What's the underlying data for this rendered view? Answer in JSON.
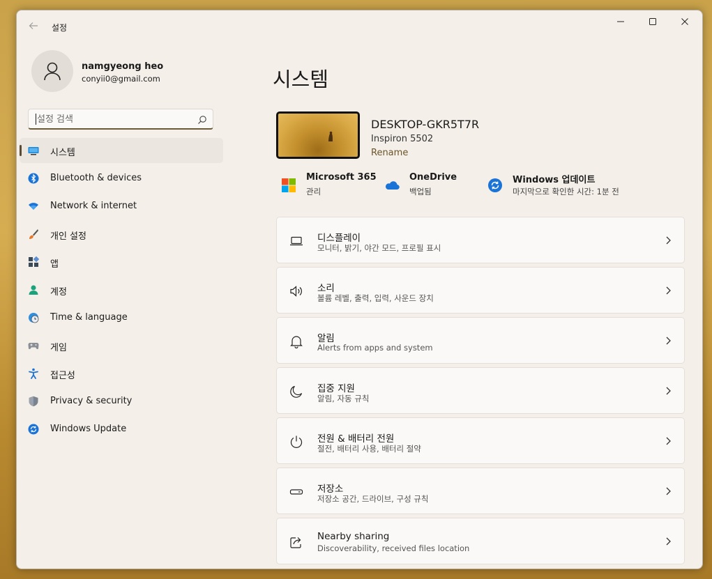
{
  "window": {
    "title": "설정",
    "back_icon": "back-arrow-icon",
    "controls": [
      "minimize-icon",
      "maximize-icon",
      "close-icon"
    ]
  },
  "profile": {
    "name": "namgyeong heo",
    "email": "conyii0@gmail.com",
    "avatar_icon": "person-icon"
  },
  "search": {
    "placeholder": "설정 검색",
    "value": ""
  },
  "sidebar": {
    "items": [
      {
        "label": "시스템",
        "icon": "monitor-icon",
        "active": true
      },
      {
        "label": "Bluetooth & devices",
        "icon": "bluetooth-icon"
      },
      {
        "label": "Network & internet",
        "icon": "wifi-icon"
      },
      {
        "label": "개인 설정",
        "icon": "brush-icon"
      },
      {
        "label": "앱",
        "icon": "apps-icon"
      },
      {
        "label": "계정",
        "icon": "account-icon"
      },
      {
        "label": "Time & language",
        "icon": "globe-clock-icon"
      },
      {
        "label": "게임",
        "icon": "gamepad-icon"
      },
      {
        "label": "접근성",
        "icon": "accessibility-icon"
      },
      {
        "label": "Privacy & security",
        "icon": "shield-icon"
      },
      {
        "label": "Windows Update",
        "icon": "update-icon"
      }
    ]
  },
  "main": {
    "title": "시스템",
    "device": {
      "name": "DESKTOP-GKR5T7R",
      "model": "Inspiron 5502",
      "rename": "Rename"
    },
    "services": [
      {
        "name": "Microsoft 365",
        "sub": "관리",
        "icon": "microsoft-logo-icon"
      },
      {
        "name": "OneDrive",
        "sub": "백업됨",
        "icon": "cloud-icon"
      },
      {
        "name": "Windows 업데이트",
        "sub": "마지막으로 확인한 시간: 1분 전",
        "icon": "update-icon"
      }
    ],
    "cards": [
      {
        "title": "디스플레이",
        "sub": "모니터, 밝기, 야간 모드, 프로필 표시",
        "icon": "laptop-icon"
      },
      {
        "title": "소리",
        "sub": "볼륨 레벨, 출력, 입력, 사운드 장치",
        "icon": "speaker-icon"
      },
      {
        "title": "알림",
        "sub": "Alerts from apps and system",
        "icon": "bell-icon"
      },
      {
        "title": "집중 지원",
        "sub": "알림, 자동 규칙",
        "icon": "moon-icon"
      },
      {
        "title": "전원 & 배터리 전원",
        "sub": "절전, 배터리 사용, 배터리 절약",
        "icon": "power-icon"
      },
      {
        "title": "저장소",
        "sub": "저장소 공간, 드라이브, 구성 규칙",
        "icon": "storage-icon"
      },
      {
        "title": "Nearby sharing",
        "sub": "Discoverability, received files location",
        "icon": "share-icon"
      }
    ]
  },
  "colors": {
    "window_bg": "#f4efe9",
    "accent": "#5a4c34",
    "rename_link": "#6a5628"
  }
}
